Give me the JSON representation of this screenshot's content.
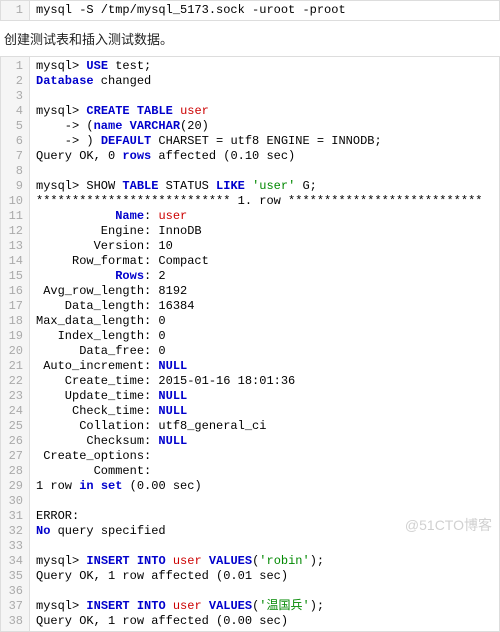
{
  "block1": {
    "lines": [
      [
        {
          "t": "mysql -S /tmp/mysql_5173.sock -uroot -proot",
          "c": ""
        }
      ]
    ]
  },
  "description": "创建测试表和插入测试数据。",
  "block2": {
    "lines": [
      [
        {
          "t": "mysql> ",
          "c": ""
        },
        {
          "t": "USE",
          "c": "kw"
        },
        {
          "t": " test;",
          "c": ""
        }
      ],
      [
        {
          "t": "Database",
          "c": "kw"
        },
        {
          "t": " changed",
          "c": ""
        }
      ],
      [
        {
          "t": "",
          "c": ""
        }
      ],
      [
        {
          "t": "mysql> ",
          "c": ""
        },
        {
          "t": "CREATE",
          "c": "kw"
        },
        {
          "t": " ",
          "c": ""
        },
        {
          "t": "TABLE",
          "c": "kw"
        },
        {
          "t": " ",
          "c": ""
        },
        {
          "t": "user",
          "c": "fn"
        }
      ],
      [
        {
          "t": "    -> (",
          "c": ""
        },
        {
          "t": "name",
          "c": "kw"
        },
        {
          "t": " ",
          "c": ""
        },
        {
          "t": "VARCHAR",
          "c": "kw"
        },
        {
          "t": "(20)",
          "c": ""
        }
      ],
      [
        {
          "t": "    -> ) ",
          "c": ""
        },
        {
          "t": "DEFAULT",
          "c": "kw"
        },
        {
          "t": " CHARSET = utf8 ENGINE = INNODB;",
          "c": ""
        }
      ],
      [
        {
          "t": "Query OK, 0 ",
          "c": ""
        },
        {
          "t": "rows",
          "c": "kw"
        },
        {
          "t": " affected (0.10 sec)",
          "c": ""
        }
      ],
      [
        {
          "t": "",
          "c": ""
        }
      ],
      [
        {
          "t": "mysql> SHOW ",
          "c": ""
        },
        {
          "t": "TABLE",
          "c": "kw"
        },
        {
          "t": " STATUS ",
          "c": ""
        },
        {
          "t": "LIKE",
          "c": "kw"
        },
        {
          "t": " ",
          "c": ""
        },
        {
          "t": "'user'",
          "c": "str"
        },
        {
          "t": " G;",
          "c": ""
        }
      ],
      [
        {
          "t": "*************************** 1. row ***************************",
          "c": ""
        }
      ],
      [
        {
          "t": "           ",
          "c": ""
        },
        {
          "t": "Name",
          "c": "kw"
        },
        {
          "t": ": ",
          "c": ""
        },
        {
          "t": "user",
          "c": "fn"
        }
      ],
      [
        {
          "t": "         Engine: InnoDB",
          "c": ""
        }
      ],
      [
        {
          "t": "        Version: 10",
          "c": ""
        }
      ],
      [
        {
          "t": "     Row_format: Compact",
          "c": ""
        }
      ],
      [
        {
          "t": "           ",
          "c": ""
        },
        {
          "t": "Rows",
          "c": "kw"
        },
        {
          "t": ": 2",
          "c": ""
        }
      ],
      [
        {
          "t": " Avg_row_length: 8192",
          "c": ""
        }
      ],
      [
        {
          "t": "    Data_length: 16384",
          "c": ""
        }
      ],
      [
        {
          "t": "Max_data_length: 0",
          "c": ""
        }
      ],
      [
        {
          "t": "   Index_length: 0",
          "c": ""
        }
      ],
      [
        {
          "t": "      Data_free: 0",
          "c": ""
        }
      ],
      [
        {
          "t": " Auto_increment: ",
          "c": ""
        },
        {
          "t": "NULL",
          "c": "kw"
        }
      ],
      [
        {
          "t": "    Create_time: 2015-01-16 18:01:36",
          "c": ""
        }
      ],
      [
        {
          "t": "    Update_time: ",
          "c": ""
        },
        {
          "t": "NULL",
          "c": "kw"
        }
      ],
      [
        {
          "t": "     Check_time: ",
          "c": ""
        },
        {
          "t": "NULL",
          "c": "kw"
        }
      ],
      [
        {
          "t": "      Collation: utf8_general_ci",
          "c": ""
        }
      ],
      [
        {
          "t": "       Checksum: ",
          "c": ""
        },
        {
          "t": "NULL",
          "c": "kw"
        }
      ],
      [
        {
          "t": " Create_options:",
          "c": ""
        }
      ],
      [
        {
          "t": "        Comment:",
          "c": ""
        }
      ],
      [
        {
          "t": "1 row ",
          "c": ""
        },
        {
          "t": "in",
          "c": "kw"
        },
        {
          "t": " ",
          "c": ""
        },
        {
          "t": "set",
          "c": "kw"
        },
        {
          "t": " (0.00 sec)",
          "c": ""
        }
      ],
      [
        {
          "t": "",
          "c": ""
        }
      ],
      [
        {
          "t": "ERROR:",
          "c": ""
        }
      ],
      [
        {
          "t": "No",
          "c": "kw"
        },
        {
          "t": " query specified",
          "c": ""
        }
      ],
      [
        {
          "t": "",
          "c": ""
        }
      ],
      [
        {
          "t": "mysql> ",
          "c": ""
        },
        {
          "t": "INSERT",
          "c": "kw"
        },
        {
          "t": " ",
          "c": ""
        },
        {
          "t": "INTO",
          "c": "kw"
        },
        {
          "t": " ",
          "c": ""
        },
        {
          "t": "user",
          "c": "fn"
        },
        {
          "t": " ",
          "c": ""
        },
        {
          "t": "VALUES",
          "c": "kw"
        },
        {
          "t": "(",
          "c": ""
        },
        {
          "t": "'robin'",
          "c": "str"
        },
        {
          "t": ");",
          "c": ""
        }
      ],
      [
        {
          "t": "Query OK, 1 row affected (0.01 sec)",
          "c": ""
        }
      ],
      [
        {
          "t": "",
          "c": ""
        }
      ],
      [
        {
          "t": "mysql> ",
          "c": ""
        },
        {
          "t": "INSERT",
          "c": "kw"
        },
        {
          "t": " ",
          "c": ""
        },
        {
          "t": "INTO",
          "c": "kw"
        },
        {
          "t": " ",
          "c": ""
        },
        {
          "t": "user",
          "c": "fn"
        },
        {
          "t": " ",
          "c": ""
        },
        {
          "t": "VALUES",
          "c": "kw"
        },
        {
          "t": "(",
          "c": ""
        },
        {
          "t": "'温国兵'",
          "c": "str"
        },
        {
          "t": ");",
          "c": ""
        }
      ],
      [
        {
          "t": "Query OK, 1 row affected (0.00 sec)",
          "c": ""
        }
      ]
    ]
  },
  "watermark": "@51CTO博客"
}
